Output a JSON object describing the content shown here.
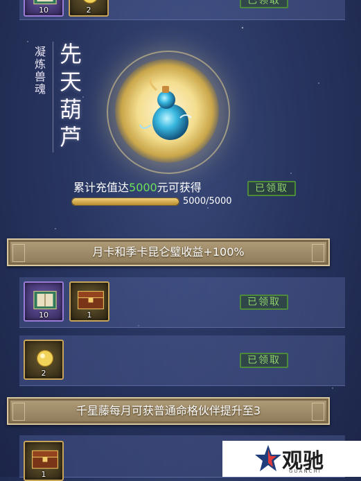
{
  "top_row": {
    "items": [
      {
        "icon": "spell-book-icon",
        "count": "10"
      },
      {
        "icon": "golden-orb-icon",
        "count": "2"
      }
    ]
  },
  "feature": {
    "side_title": "凝炼兽魂",
    "main_title": "先天葫芦",
    "item_icon": "spirit-gourd-icon",
    "desc_prefix": "累计充值达",
    "desc_amount": "5000",
    "desc_suffix": "元可获得",
    "claim_label": "已领取",
    "progress_text": "5000/5000",
    "progress_fraction": 1.0
  },
  "banner_1": {
    "text": "月卡和季卡昆仑璧收益+100%"
  },
  "row_2": {
    "items": [
      {
        "icon": "spell-book-icon",
        "count": "10"
      },
      {
        "icon": "treasure-chest-icon",
        "count": "1"
      }
    ],
    "claim_label": "已领取"
  },
  "row_3": {
    "items": [
      {
        "icon": "golden-orb-icon",
        "count": "2"
      }
    ],
    "claim_label": "已领取"
  },
  "banner_2": {
    "text": "千星藤每月可获普通命格伙伴提升至3"
  },
  "row_4": {
    "items": [
      {
        "icon": "treasure-chest-icon",
        "count": "1"
      }
    ]
  },
  "logo": {
    "main": "观驰",
    "sub": "GUANCHI"
  },
  "colors": {
    "background": "#283560",
    "claim_green": "#8fd26a",
    "highlight_green": "#6ee05a",
    "banner_gold": "#b09c78",
    "item_border_gold": "#c9a55a",
    "item_border_purple": "#9b7bd8"
  }
}
